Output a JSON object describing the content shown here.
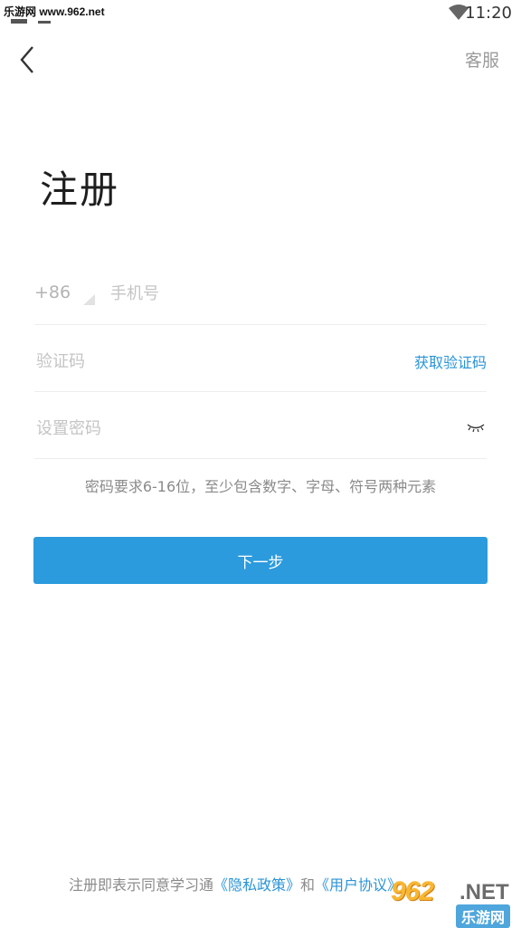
{
  "status_bar": {
    "watermark": "乐游网 www.962.net",
    "time": "11:20"
  },
  "header": {
    "service_label": "客服"
  },
  "page_title": "注册",
  "form": {
    "country_code": "+86",
    "phone_placeholder": "手机号",
    "code_placeholder": "验证码",
    "get_code_label": "获取验证码",
    "password_placeholder": "设置密码",
    "password_hint": "密码要求6-16位，至少包含数字、字母、符号两种元素"
  },
  "next_button_label": "下一步",
  "footer": {
    "prefix": "注册即表示同意学习通",
    "privacy_link": "《隐私政策》",
    "and": "和",
    "agreement_link": "《用户协议》"
  },
  "watermark_bottom": {
    "brand": "962",
    "suffix": ".NET",
    "cn": "乐游网"
  },
  "colors": {
    "accent": "#2b9bdd",
    "link": "#2a94d6",
    "placeholder": "#c4c4c4"
  }
}
